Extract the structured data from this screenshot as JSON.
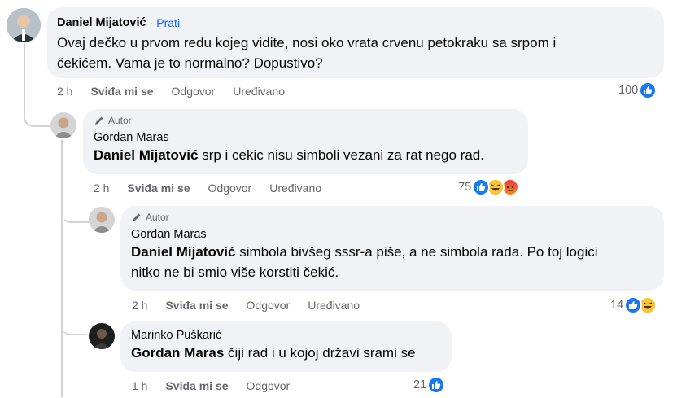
{
  "comments": [
    {
      "author": "Daniel Mijatović",
      "separator": "·",
      "follow": "Prati",
      "text_line1": "Ovaj dečko u prvom redu kojeg vidite, nosi oko vrata crvenu petokraku sa srpom i",
      "text_line2": "čekićem. Vama je to normalno? Dopustivo?",
      "time": "2 h",
      "like": "Sviđa mi se",
      "reply": "Odgovor",
      "edited": "Uređivano",
      "reactions_count": "100"
    },
    {
      "badge": "Autor",
      "author": "Gordan Maras",
      "mention": "Daniel Mijatović",
      "text": " srp i cekic nisu simboli vezani za rat nego rad.",
      "time": "2 h",
      "like": "Sviđa mi se",
      "reply": "Odgovor",
      "edited": "Uređivano",
      "reactions_count": "75"
    },
    {
      "badge": "Autor",
      "author": "Gordan Maras",
      "mention": "Daniel Mijatović",
      "text_line1": " simbola bivšeg sssr-a piše, a ne simbola rada. Po toj logici",
      "text_line2": "nitko ne bi smio više korstiti čekić.",
      "time": "2 h",
      "like": "Sviđa mi se",
      "reply": "Odgovor",
      "edited": "Uređivano",
      "reactions_count": "14"
    },
    {
      "author": "Marinko Puškarić",
      "mention": "Gordan Maras",
      "text": " čiji rad i u kojoj državi srami se",
      "time": "1 h",
      "like": "Sviđa mi se",
      "reply": "Odgovor",
      "reactions_count": "21"
    }
  ],
  "colors": {
    "bubble": "#f0f2f5",
    "meta": "#65676b",
    "like": "#1877f2",
    "follow": "#0866ff"
  }
}
